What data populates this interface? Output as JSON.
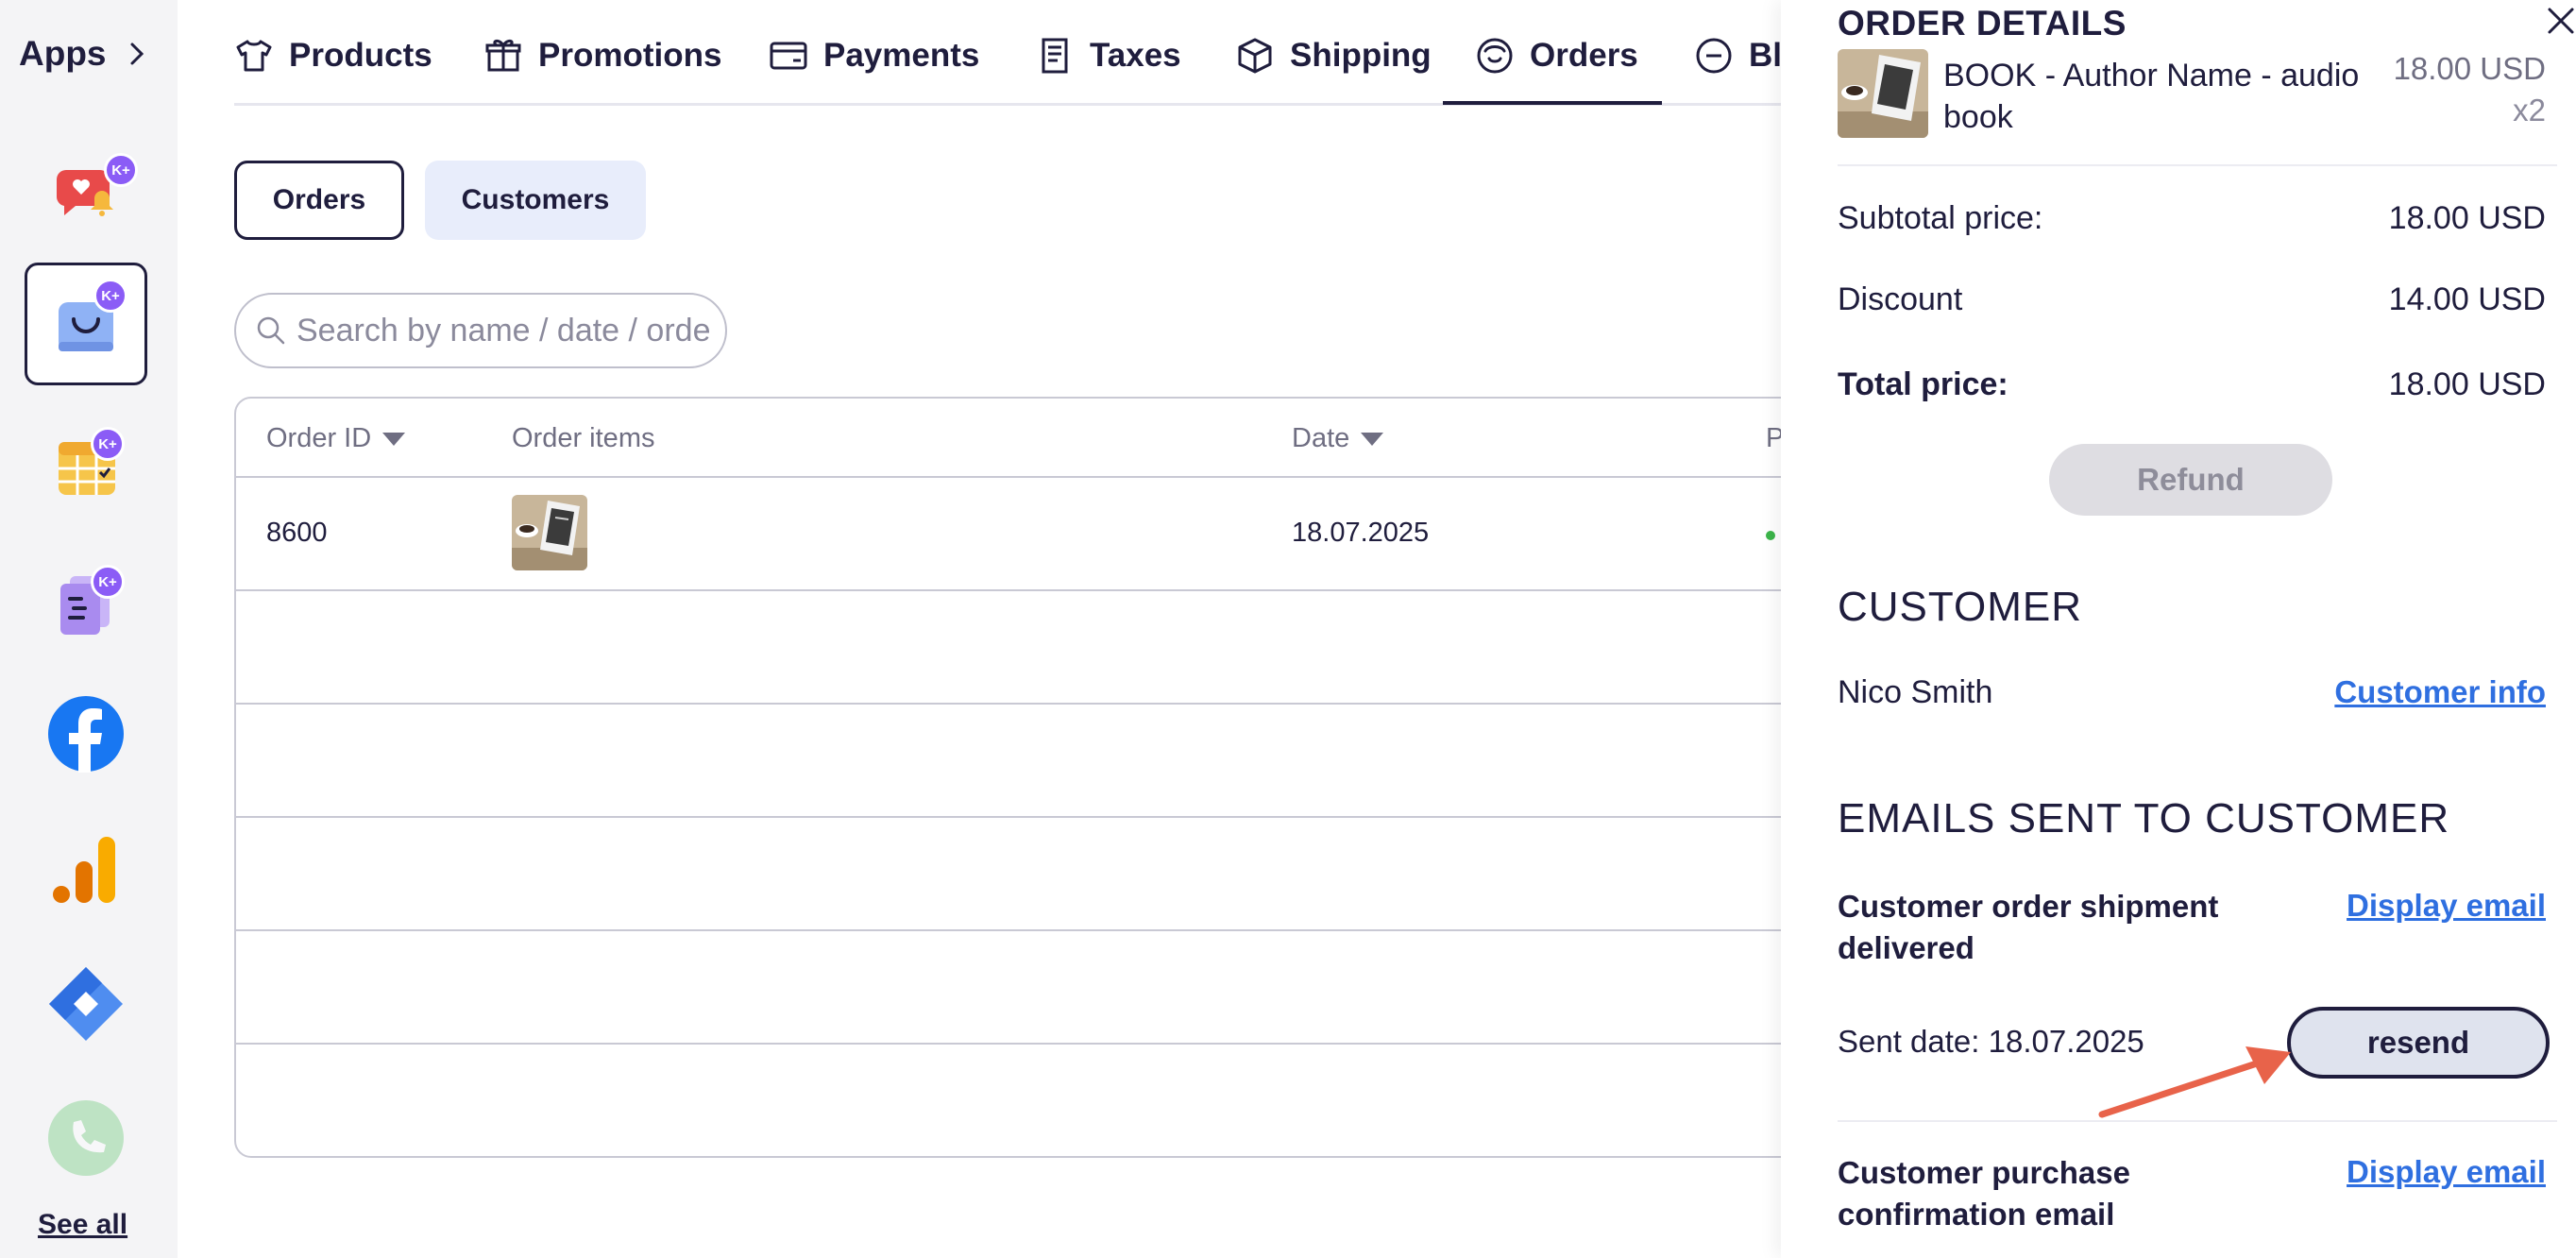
{
  "sidebar": {
    "title": "Apps",
    "apps": [
      {
        "name": "notifications-app",
        "badge": "K+"
      },
      {
        "name": "shop-app",
        "badge": "K+"
      },
      {
        "name": "calendar-app",
        "badge": "K+"
      },
      {
        "name": "documents-app",
        "badge": "K+"
      },
      {
        "name": "facebook-app"
      },
      {
        "name": "analytics-app"
      },
      {
        "name": "tag-manager-app"
      },
      {
        "name": "phone-app"
      }
    ],
    "see_all": "See all"
  },
  "nav": {
    "tabs": [
      {
        "label": "Products",
        "icon": "tshirt-icon"
      },
      {
        "label": "Promotions",
        "icon": "gift-icon"
      },
      {
        "label": "Payments",
        "icon": "card-icon"
      },
      {
        "label": "Taxes",
        "icon": "receipt-icon"
      },
      {
        "label": "Shipping",
        "icon": "box-icon"
      },
      {
        "label": "Orders",
        "icon": "bag-icon",
        "active": true
      },
      {
        "label": "Bla",
        "icon": "minus-circle-icon"
      }
    ]
  },
  "segments": {
    "orders": "Orders",
    "customers": "Customers"
  },
  "search": {
    "placeholder": "Search by name / date / order"
  },
  "table": {
    "headers": {
      "order_id": "Order ID",
      "order_items": "Order items",
      "date": "Date",
      "partial": "P"
    },
    "rows": [
      {
        "order_id": "8600",
        "date": "18.07.2025"
      }
    ]
  },
  "order_details": {
    "title": "ORDER DETAILS",
    "item": {
      "name": "BOOK - Author Name - audio book",
      "price": "18.00 USD",
      "qty": "x2"
    },
    "subtotal_label": "Subtotal price:",
    "subtotal_value": "18.00 USD",
    "discount_label": "Discount",
    "discount_value": "14.00 USD",
    "total_label": "Total price:",
    "total_value": "18.00 USD",
    "refund": "Refund"
  },
  "customer": {
    "title": "CUSTOMER",
    "name": "Nico Smith",
    "info_link": "Customer info"
  },
  "emails": {
    "title": "EMAILS SENT TO CUSTOMER",
    "items": [
      {
        "title": "Customer order shipment delivered",
        "link": "Display email",
        "sent_date": "Sent date: 18.07.2025",
        "resend": "resend"
      },
      {
        "title": "Customer purchase confirmation email",
        "link": "Display email"
      }
    ]
  },
  "colors": {
    "primary": "#1f1d3d",
    "link": "#2f6fe0",
    "badge": "#8b5cf6",
    "annotation_arrow": "#e8634a"
  }
}
